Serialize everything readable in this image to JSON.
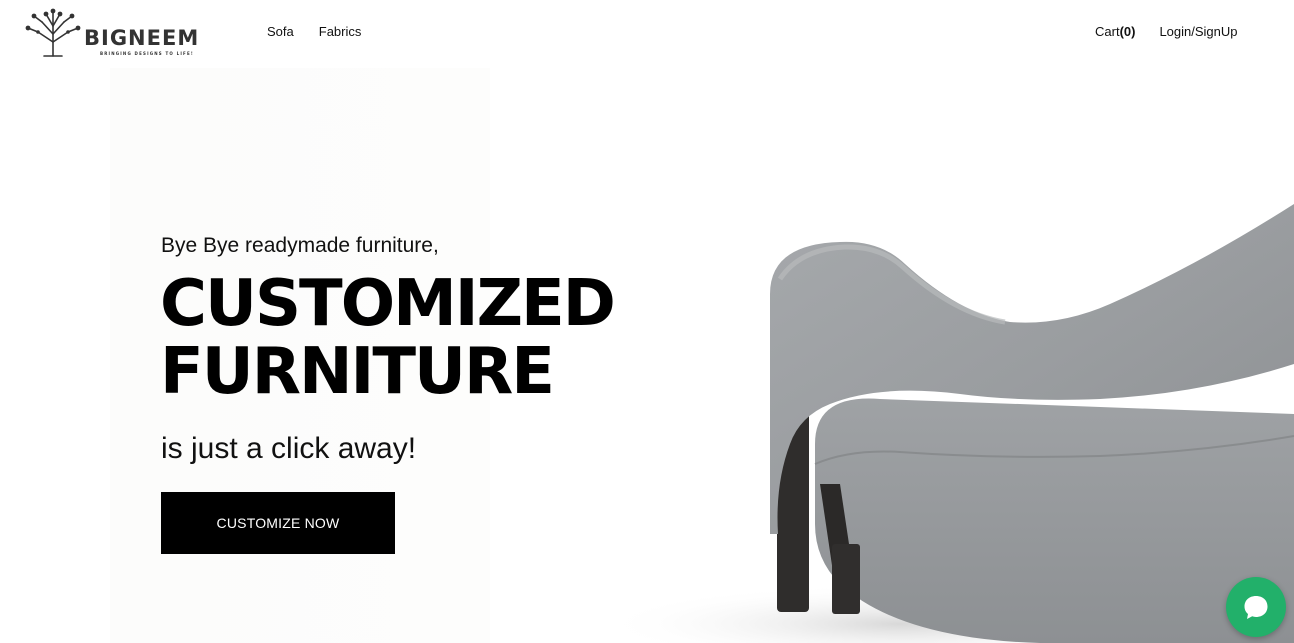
{
  "brand": {
    "name": "BIGNEEM",
    "tagline": "BRINGING DESIGNS TO LIFE!",
    "logo_icon": "tree-icon"
  },
  "nav": {
    "items": [
      {
        "label": "Sofa"
      },
      {
        "label": "Fabrics"
      }
    ]
  },
  "account": {
    "cart_label": "Cart",
    "cart_count": "(0)",
    "login_label": "Login/SignUp"
  },
  "hero": {
    "pre_title": "Bye Bye readymade furniture,",
    "title_line1": "CUSTOMIZED",
    "title_line2": "FURNITURE",
    "subtitle": "is just a click away!",
    "cta_label": "CUSTOMIZE NOW"
  },
  "chat": {
    "icon": "chat-bubble-icon",
    "color": "#22b06a"
  }
}
